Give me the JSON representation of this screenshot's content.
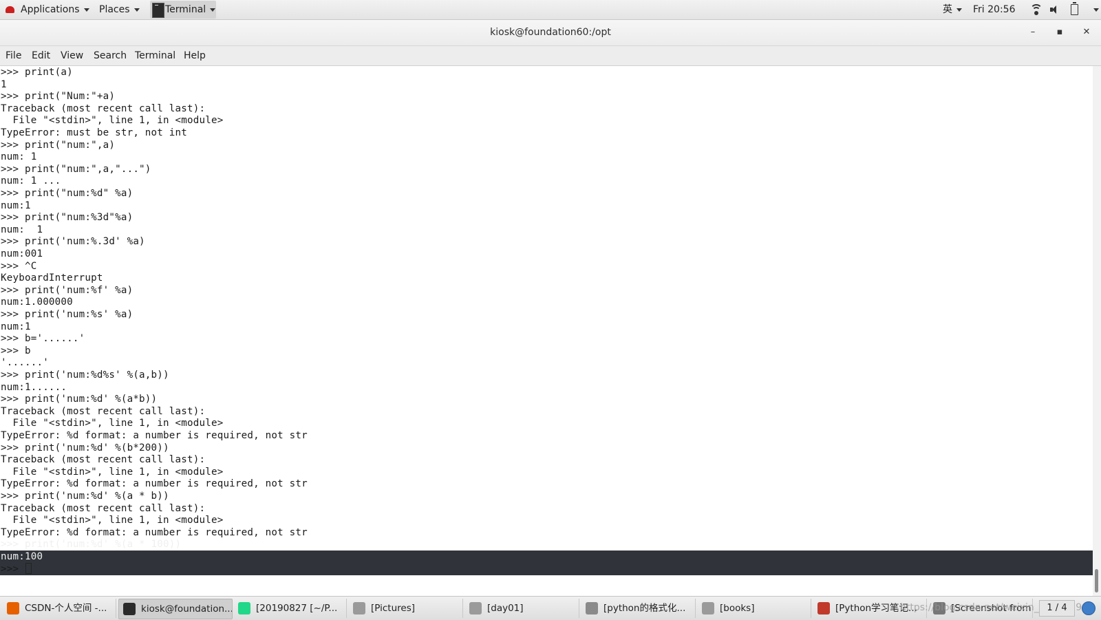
{
  "top_panel": {
    "applications_label": "Applications",
    "places_label": "Places",
    "terminal_label": "Terminal",
    "input_method": "英",
    "clock": "Fri 20:56"
  },
  "window": {
    "title": "kiosk@foundation60:/opt",
    "minimize_glyph": "–",
    "maximize_glyph": "▪",
    "close_glyph": "✕"
  },
  "menu": {
    "items": [
      "File",
      "Edit",
      "View",
      "Search",
      "Terminal",
      "Help"
    ]
  },
  "terminal": {
    "lines": [
      ">>> print(a)",
      "1",
      ">>> print(\"Num:\"+a)",
      "Traceback (most recent call last):",
      "  File \"<stdin>\", line 1, in <module>",
      "TypeError: must be str, not int",
      ">>> print(\"num:\",a)",
      "num: 1",
      ">>> print(\"num:\",a,\"...\")",
      "num: 1 ...",
      ">>> print(\"num:%d\" %a)",
      "num:1",
      ">>> print(\"num:%3d\"%a)",
      "num:  1",
      ">>> print('num:%.3d' %a)",
      "num:001",
      ">>> ^C",
      "KeyboardInterrupt",
      ">>> print('num:%f' %a)",
      "num:1.000000",
      ">>> print('num:%s' %a)",
      "num:1",
      ">>> b='......'",
      ">>> b",
      "'......'",
      ">>> print('num:%d%s' %(a,b))",
      "num:1......",
      ">>> print('num:%d' %(a*b))",
      "Traceback (most recent call last):",
      "  File \"<stdin>\", line 1, in <module>",
      "TypeError: %d format: a number is required, not str",
      ">>> print('num:%d' %(b*200))",
      "Traceback (most recent call last):",
      "  File \"<stdin>\", line 1, in <module>",
      "TypeError: %d format: a number is required, not str",
      ">>> print('num:%d' %(a * b))",
      "Traceback (most recent call last):",
      "  File \"<stdin>\", line 1, in <module>",
      "TypeError: %d format: a number is required, not str",
      ">>> print('num:%d' %(a * 100))",
      "num:100"
    ],
    "prompt": ">>> "
  },
  "taskbar": {
    "tasks": [
      {
        "label": "CSDN-个人空间 -...",
        "icon": "firefox-icon",
        "color": "#e66000"
      },
      {
        "label": "kiosk@foundation...",
        "icon": "terminal-icon",
        "color": "#2b2b2b"
      },
      {
        "label": "[20190827 [~/P...",
        "icon": "pycharm-icon",
        "color": "#21d789"
      },
      {
        "label": "[Pictures]",
        "icon": "folder-icon",
        "color": "#9a9a9a"
      },
      {
        "label": "[day01]",
        "icon": "folder-icon",
        "color": "#9a9a9a"
      },
      {
        "label": "[python的格式化...",
        "icon": "text-editor-icon",
        "color": "#8a8a8a"
      },
      {
        "label": "[books]",
        "icon": "folder-icon",
        "color": "#9a9a9a"
      },
      {
        "label": "[Python学习笔记...",
        "icon": "document-icon",
        "color": "#c0392b"
      },
      {
        "label": "[Screenshot from ...",
        "icon": "screenshot-icon",
        "color": "#777777"
      }
    ],
    "watermark": "https://blog.csdn.net/weixin_4328859",
    "pager": "1 / 4"
  }
}
